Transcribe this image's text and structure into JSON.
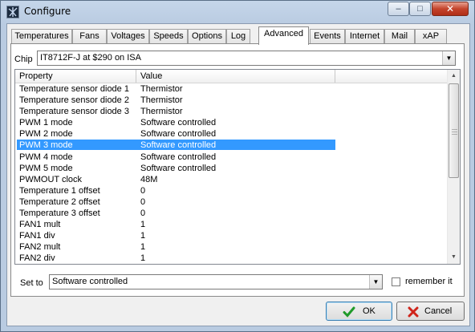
{
  "window": {
    "title": "Configure"
  },
  "caption_buttons": {
    "minimize": "–",
    "maximize": "□",
    "close": "✕"
  },
  "tabs": [
    {
      "label": "Temperatures",
      "active": false
    },
    {
      "label": "Fans",
      "active": false
    },
    {
      "label": "Voltages",
      "active": false
    },
    {
      "label": "Speeds",
      "active": false
    },
    {
      "label": "Options",
      "active": false
    },
    {
      "label": "Log",
      "active": false
    },
    {
      "label": "Advanced",
      "active": true
    },
    {
      "label": "Events",
      "active": false
    },
    {
      "label": "Internet",
      "active": false
    },
    {
      "label": "Mail",
      "active": false
    },
    {
      "label": "xAP",
      "active": false
    }
  ],
  "chip": {
    "label": "Chip",
    "value": "IT8712F-J at $290 on ISA"
  },
  "grid": {
    "columns": [
      "Property",
      "Value"
    ],
    "selected_row": 5,
    "rows": [
      {
        "property": "Temperature sensor diode 1",
        "value": "Thermistor"
      },
      {
        "property": "Temperature sensor diode 2",
        "value": "Thermistor"
      },
      {
        "property": "Temperature sensor diode 3",
        "value": "Thermistor"
      },
      {
        "property": "PWM 1 mode",
        "value": "Software controlled"
      },
      {
        "property": "PWM 2 mode",
        "value": "Software controlled"
      },
      {
        "property": "PWM 3 mode",
        "value": "Software controlled"
      },
      {
        "property": "PWM 4 mode",
        "value": "Software controlled"
      },
      {
        "property": "PWM 5 mode",
        "value": "Software controlled"
      },
      {
        "property": "PWMOUT clock",
        "value": "48M"
      },
      {
        "property": "Temperature 1 offset",
        "value": "0"
      },
      {
        "property": "Temperature 2 offset",
        "value": "0"
      },
      {
        "property": "Temperature 3 offset",
        "value": "0"
      },
      {
        "property": "FAN1 mult",
        "value": "1"
      },
      {
        "property": "FAN1 div",
        "value": "1"
      },
      {
        "property": "FAN2 mult",
        "value": "1"
      },
      {
        "property": "FAN2 div",
        "value": "1"
      }
    ]
  },
  "set_to": {
    "label": "Set to",
    "value": "Software controlled"
  },
  "remember": {
    "label": "remember it",
    "checked": false
  },
  "buttons": {
    "ok": "OK",
    "cancel": "Cancel"
  }
}
